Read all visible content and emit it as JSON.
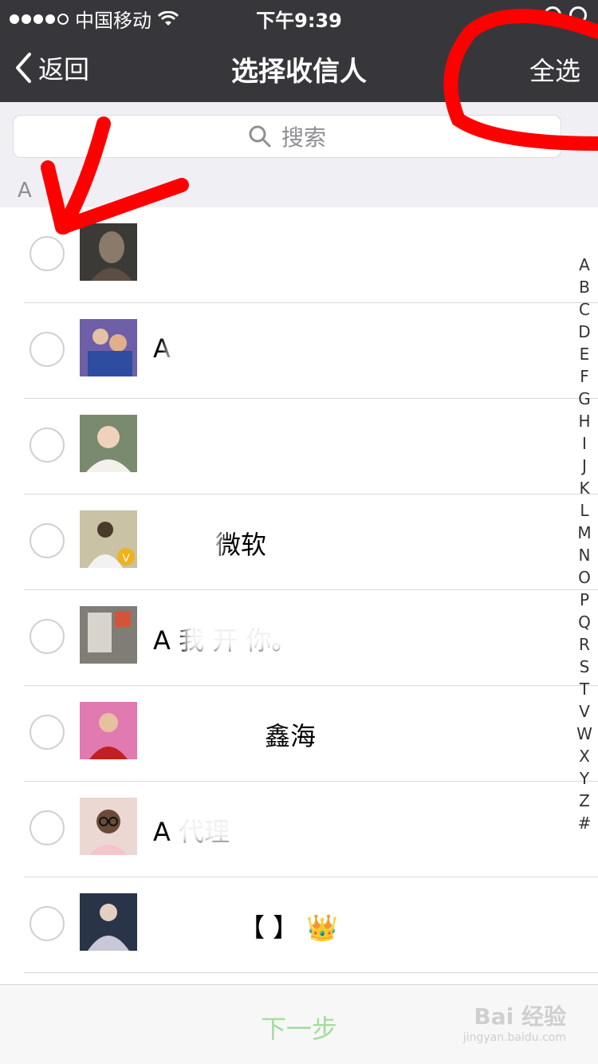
{
  "status_bar": {
    "carrier": "中国移动",
    "time": "下午9:39"
  },
  "navbar": {
    "back_label": "返回",
    "title": "选择收信人",
    "select_all_label": "全选"
  },
  "search": {
    "placeholder": "搜索"
  },
  "section": {
    "header": "A"
  },
  "contacts": [
    {
      "name": ""
    },
    {
      "name": "A"
    },
    {
      "name": ""
    },
    {
      "name": "微软"
    },
    {
      "name": "A 我 开 你。"
    },
    {
      "name": "鑫海 "
    },
    {
      "name": "A 代理"
    },
    {
      "name": "【 】 👑"
    }
  ],
  "index_letters": [
    "A",
    "B",
    "C",
    "D",
    "E",
    "F",
    "G",
    "H",
    "I",
    "J",
    "K",
    "L",
    "M",
    "N",
    "O",
    "P",
    "Q",
    "R",
    "S",
    "T",
    "V",
    "W",
    "X",
    "Y",
    "Z",
    "#"
  ],
  "toolbar": {
    "next_label": "下一步"
  },
  "watermark": {
    "brand": "Bai 经验",
    "url": "jingyan.baidu.com"
  },
  "colors": {
    "topbar": "#37373b",
    "next_disabled": "#a6dba0",
    "annotation_red": "#ff0000"
  }
}
